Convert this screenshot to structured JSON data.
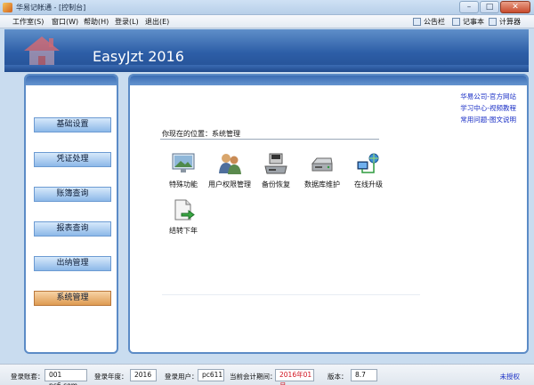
{
  "window": {
    "title": "华易记帐通 - [控制台]"
  },
  "menu": {
    "items": [
      "工作室(S)",
      "窗口(W)",
      "帮助(H)",
      "登录(L)",
      "退出(E)"
    ],
    "tools": [
      "公告栏",
      "记事本",
      "计算器"
    ]
  },
  "banner": {
    "title": "EasyJzt 2016"
  },
  "sidebar": {
    "items": [
      {
        "label": "基础设置"
      },
      {
        "label": "凭证处理"
      },
      {
        "label": "账簿查询"
      },
      {
        "label": "报表查询"
      },
      {
        "label": "出纳管理"
      },
      {
        "label": "系统管理"
      }
    ],
    "active": "系统管理"
  },
  "main": {
    "links": [
      "华易公司-官方网站",
      "学习中心-视频教程",
      "常用问题-图文说明"
    ],
    "location": "你现在的位置：系统管理",
    "functions": [
      {
        "label": "特殊功能",
        "icon": "monitor-icon"
      },
      {
        "label": "用户权限管理",
        "icon": "users-icon"
      },
      {
        "label": "备份恢复",
        "icon": "backup-drive-icon"
      },
      {
        "label": "数据库维护",
        "icon": "disk-drive-icon"
      },
      {
        "label": "在线升级",
        "icon": "network-icon"
      },
      {
        "label": "结转下年",
        "icon": "document-arrow-icon"
      }
    ]
  },
  "status": {
    "account_label": "登录账套：",
    "account": "001 pc6.com",
    "year_label": "登录年度：",
    "year": "2016",
    "user_label": "登录用户：",
    "user": "pc611",
    "period_label": "当前会计期间：",
    "period": "2016年01月",
    "version_label": "版本：",
    "version": "8.7",
    "license": "未授权"
  },
  "colors": {
    "accent": "#2d5ea7",
    "active": "#de9b52",
    "link": "#1a2fc6",
    "period": "#d1121e"
  }
}
